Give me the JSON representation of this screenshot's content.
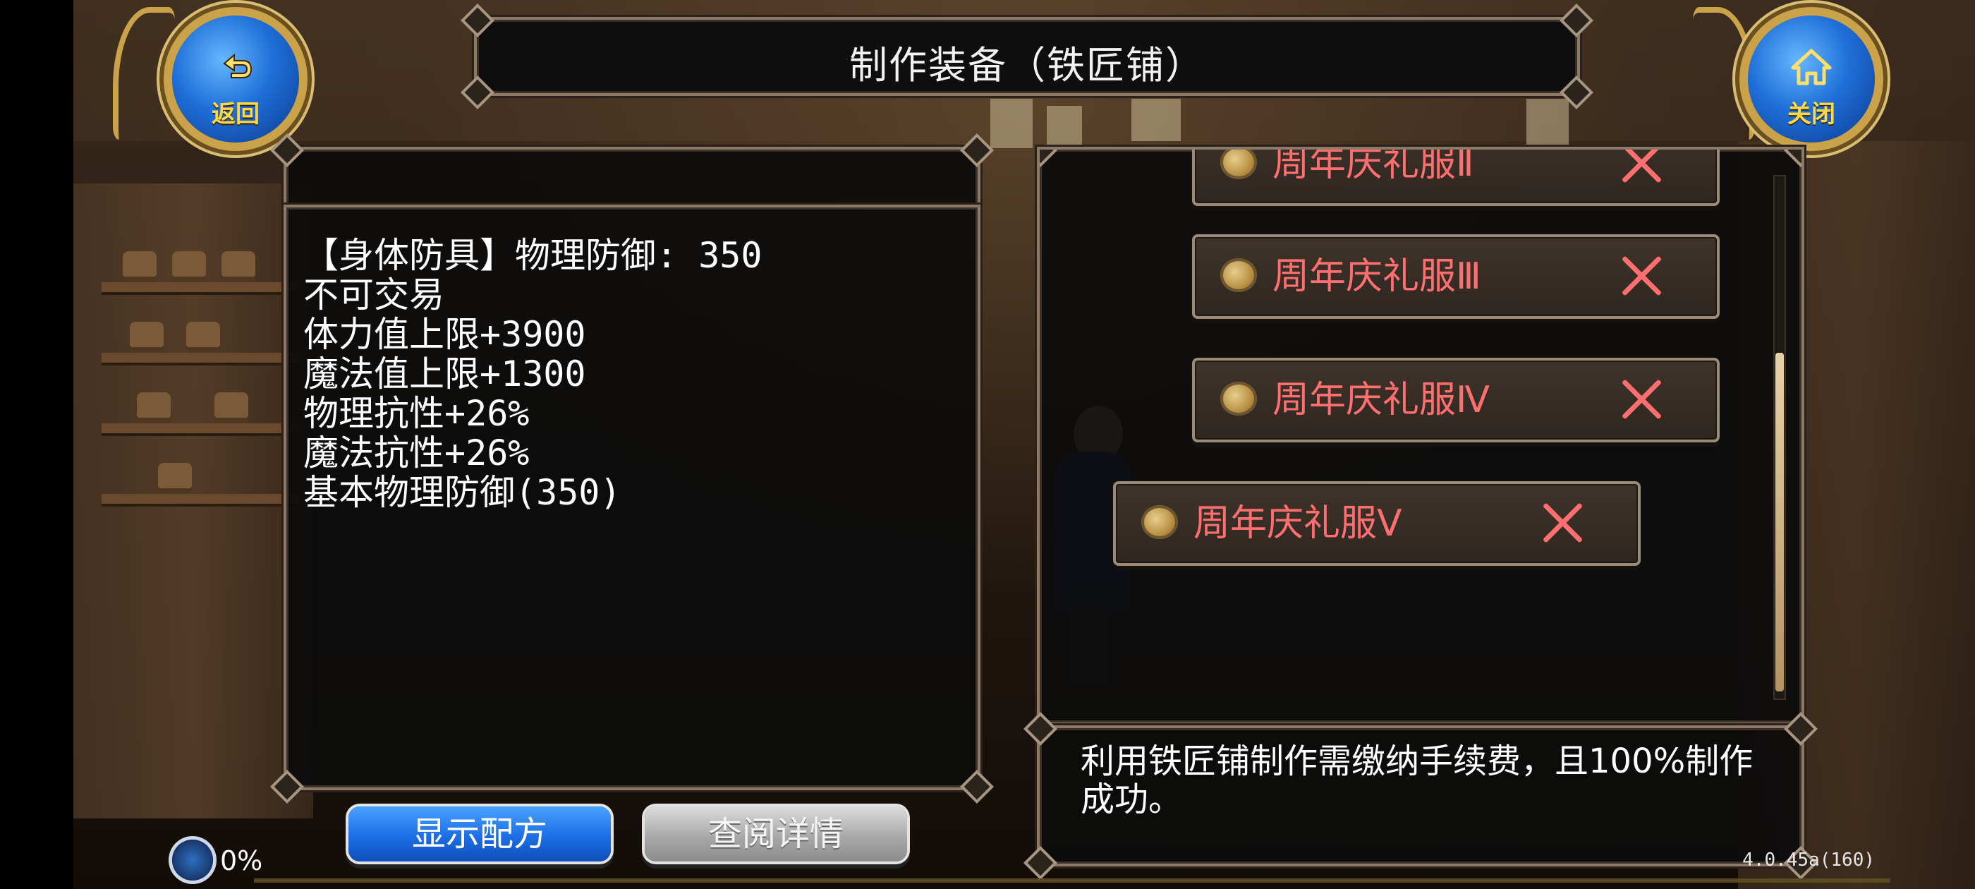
{
  "header": {
    "title": "制作装备（铁匠铺）",
    "back_button_label": "返回",
    "back_icon": "return-arrow-icon",
    "close_button_label": "关闭",
    "close_icon": "home-icon"
  },
  "item_details": {
    "lines": [
      "【身体防具】物理防御: 350",
      "不可交易",
      "体力值上限+3900",
      "魔法值上限+1300",
      "物理抗性+26%",
      "魔法抗性+26%",
      "基本物理防御(350)"
    ]
  },
  "recipe_list": {
    "items": [
      {
        "label": "周年庆礼服Ⅱ",
        "icon": "costume-icon",
        "status_icon": "cross-icon"
      },
      {
        "label": "周年庆礼服Ⅲ",
        "icon": "costume-icon",
        "status_icon": "cross-icon"
      },
      {
        "label": "周年庆礼服Ⅳ",
        "icon": "costume-icon",
        "status_icon": "cross-icon"
      },
      {
        "label": "周年庆礼服Ⅴ",
        "icon": "costume-icon",
        "status_icon": "cross-icon"
      }
    ],
    "selected_index": 3
  },
  "note": {
    "text": "利用铁匠铺制作需缴纳手续费，且100%制作成功。"
  },
  "buttons": {
    "show_recipe": "显示配方",
    "view_details": "查阅详情"
  },
  "status": {
    "progress_text": "0%",
    "progress_fraction": 0,
    "version": "4.0.45a(160)"
  },
  "colors": {
    "item_label": "#ff6f6f",
    "accent_blue": "#1c6ee6",
    "gold": "#c9a24a"
  }
}
